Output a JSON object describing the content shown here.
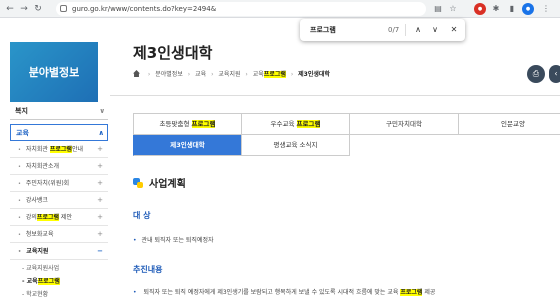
{
  "browser": {
    "url": "guro.go.kr/www/contents.do?key=2494&",
    "back_icon": "back-arrow-icon",
    "forward_icon": "forward-arrow-icon",
    "reload_icon": "reload-icon"
  },
  "findbar": {
    "query": "프로그램",
    "count": "0/7"
  },
  "sidebar": {
    "banner": "분야별정보",
    "category_welfare": "복지",
    "category_education": "교육",
    "items": [
      {
        "before": "자치회관 ",
        "hl": "프로그램",
        "after": "안내"
      },
      {
        "before": "자치회관소개",
        "hl": "",
        "after": ""
      },
      {
        "before": "주민자치(위원)회",
        "hl": "",
        "after": ""
      },
      {
        "before": "강사뱅크",
        "hl": "",
        "after": ""
      },
      {
        "before": "강의",
        "hl": "프로그램",
        "after": " 제안"
      },
      {
        "before": "청보화교육",
        "hl": "",
        "after": ""
      },
      {
        "before": "교육지원",
        "hl": "",
        "after": ""
      }
    ],
    "sub_items": [
      {
        "before": "교육지원사업",
        "hl": "",
        "after": ""
      },
      {
        "before": "교육",
        "hl": "프로그램",
        "after": ""
      },
      {
        "before": "학교현황",
        "hl": "",
        "after": ""
      }
    ]
  },
  "main": {
    "title": "제3인생대학",
    "breadcrumb": {
      "c1": "분야별정보",
      "c2": "교육",
      "c3": "교육지원",
      "c4_before": "교육",
      "c4_hl": "프로그램",
      "c5": "제3인생대학"
    },
    "tabs": [
      {
        "before": "초등맞춤형 ",
        "hl": "프로그램",
        "after": ""
      },
      {
        "before": "우수교육 ",
        "hl": "프로그램",
        "after": ""
      },
      {
        "before": "구민자치대학",
        "hl": "",
        "after": ""
      },
      {
        "before": "인문교양",
        "hl": "",
        "after": ""
      },
      {
        "before": "제3인생대학",
        "hl": "",
        "after": ""
      },
      {
        "before": "평생교육 소식지",
        "hl": "",
        "after": ""
      }
    ],
    "section_title": "사업계획",
    "subsection_target": "대 상",
    "target_text": "관내 퇴직자 또는 퇴직예정자",
    "subsection_progress": "추진내용",
    "progress_before": "퇴직자 또는 퇴직 예정자에게 제3인생기를 보람되고 행복하게 보낼 수 있도록 시대적 흐름에 맞는 교육 ",
    "progress_hl": "프로그램",
    "progress_after": " 제공"
  },
  "colors": {
    "accent": "#3478d8",
    "highlight": "#ffff00",
    "banner": "#2a95c9"
  }
}
